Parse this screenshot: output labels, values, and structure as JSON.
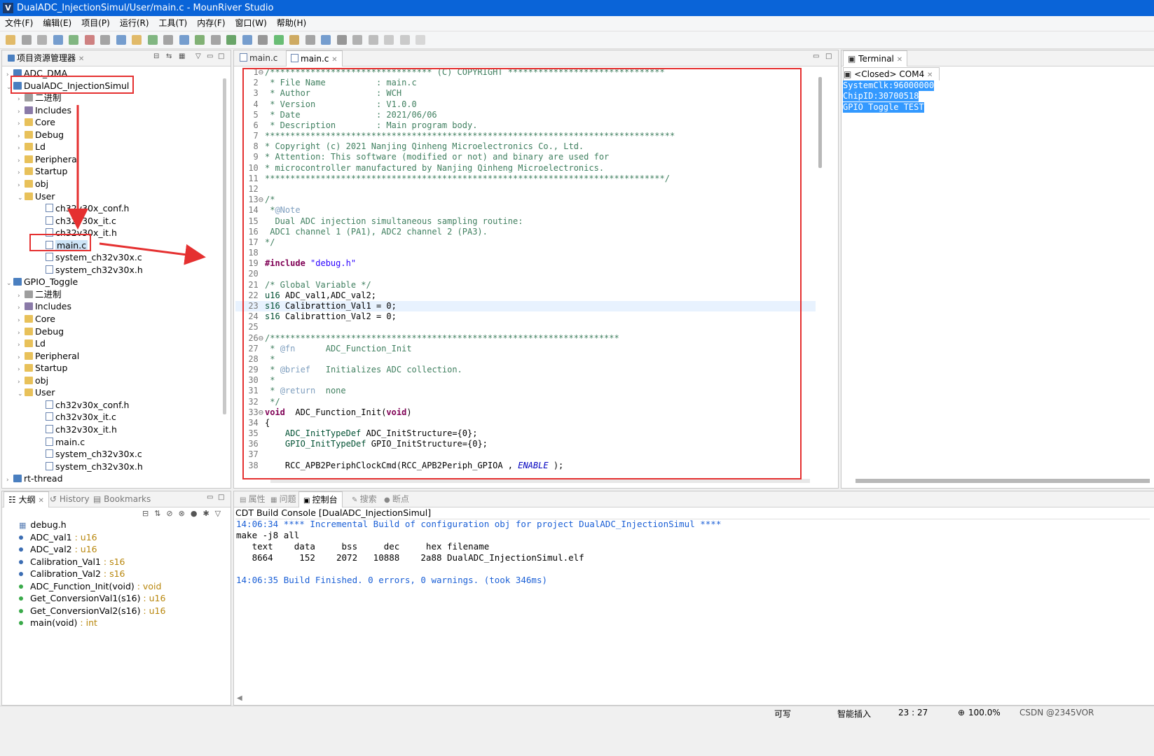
{
  "window": {
    "title": "DualADC_InjectionSimul/User/main.c - MounRiver Studio",
    "logo": "V"
  },
  "menu": [
    "文件(F)",
    "编辑(E)",
    "项目(P)",
    "运行(R)",
    "工具(T)",
    "内存(F)",
    "窗口(W)",
    "帮助(H)"
  ],
  "project_explorer": {
    "title": "项目资源管理器",
    "items": [
      {
        "label": "ADC_DMA",
        "depth": 0,
        "icon": "project",
        "expand": ">"
      },
      {
        "label": "DualADC_InjectionSimul",
        "depth": 0,
        "icon": "project",
        "expand": "v"
      },
      {
        "label": "二进制",
        "depth": 1,
        "icon": "binary",
        "expand": ">"
      },
      {
        "label": "Includes",
        "depth": 1,
        "icon": "library",
        "expand": ">"
      },
      {
        "label": "Core",
        "depth": 1,
        "icon": "folder",
        "expand": ">"
      },
      {
        "label": "Debug",
        "depth": 1,
        "icon": "folder",
        "expand": ">"
      },
      {
        "label": "Ld",
        "depth": 1,
        "icon": "folder",
        "expand": ">"
      },
      {
        "label": "Peripheral",
        "depth": 1,
        "icon": "folder",
        "expand": ">"
      },
      {
        "label": "Startup",
        "depth": 1,
        "icon": "folder",
        "expand": ">"
      },
      {
        "label": "obj",
        "depth": 1,
        "icon": "folder",
        "expand": ">"
      },
      {
        "label": "User",
        "depth": 1,
        "icon": "folder",
        "expand": "v"
      },
      {
        "label": "ch32v30x_conf.h",
        "depth": 2,
        "icon": "file",
        "expand": ""
      },
      {
        "label": "ch32v30x_it.c",
        "depth": 2,
        "icon": "file",
        "expand": ""
      },
      {
        "label": "ch32v30x_it.h",
        "depth": 2,
        "icon": "file",
        "expand": ""
      },
      {
        "label": "main.c",
        "depth": 2,
        "icon": "file",
        "expand": "",
        "selected": true
      },
      {
        "label": "system_ch32v30x.c",
        "depth": 2,
        "icon": "file",
        "expand": ""
      },
      {
        "label": "system_ch32v30x.h",
        "depth": 2,
        "icon": "file",
        "expand": ""
      },
      {
        "label": "GPIO_Toggle",
        "depth": 0,
        "icon": "project",
        "expand": "v"
      },
      {
        "label": "二进制",
        "depth": 1,
        "icon": "binary",
        "expand": ">"
      },
      {
        "label": "Includes",
        "depth": 1,
        "icon": "library",
        "expand": ">"
      },
      {
        "label": "Core",
        "depth": 1,
        "icon": "folder",
        "expand": ">"
      },
      {
        "label": "Debug",
        "depth": 1,
        "icon": "folder",
        "expand": ">"
      },
      {
        "label": "Ld",
        "depth": 1,
        "icon": "folder",
        "expand": ">"
      },
      {
        "label": "Peripheral",
        "depth": 1,
        "icon": "folder",
        "expand": ">"
      },
      {
        "label": "Startup",
        "depth": 1,
        "icon": "folder",
        "expand": ">"
      },
      {
        "label": "obj",
        "depth": 1,
        "icon": "folder",
        "expand": ">"
      },
      {
        "label": "User",
        "depth": 1,
        "icon": "folder",
        "expand": "v"
      },
      {
        "label": "ch32v30x_conf.h",
        "depth": 2,
        "icon": "file",
        "expand": ""
      },
      {
        "label": "ch32v30x_it.c",
        "depth": 2,
        "icon": "file",
        "expand": ""
      },
      {
        "label": "ch32v30x_it.h",
        "depth": 2,
        "icon": "file",
        "expand": ""
      },
      {
        "label": "main.c",
        "depth": 2,
        "icon": "file",
        "expand": ""
      },
      {
        "label": "system_ch32v30x.c",
        "depth": 2,
        "icon": "file",
        "expand": ""
      },
      {
        "label": "system_ch32v30x.h",
        "depth": 2,
        "icon": "file",
        "expand": ""
      },
      {
        "label": "rt-thread",
        "depth": 0,
        "icon": "project",
        "expand": ">"
      }
    ]
  },
  "editor": {
    "tabs": [
      "main.c",
      "main.c"
    ],
    "lines": [
      [
        [
          "c-com",
          "/******************************** (C) COPYRIGHT *******************************"
        ]
      ],
      [
        [
          "c-com",
          " * File Name          : main.c"
        ]
      ],
      [
        [
          "c-com",
          " * Author             : WCH"
        ]
      ],
      [
        [
          "c-com",
          " * Version            : V1.0.0"
        ]
      ],
      [
        [
          "c-com",
          " * Date               : 2021/06/06"
        ]
      ],
      [
        [
          "c-com",
          " * Description        : Main program body."
        ]
      ],
      [
        [
          "c-com",
          "*********************************************************************************"
        ]
      ],
      [
        [
          "c-com",
          "* Copyright (c) 2021 Nanjing Qinheng Microelectronics Co., Ltd."
        ]
      ],
      [
        [
          "c-com",
          "* Attention: This software (modified or not) and binary are used for"
        ]
      ],
      [
        [
          "c-com",
          "* microcontroller manufactured by Nanjing Qinheng Microelectronics."
        ]
      ],
      [
        [
          "c-com",
          "*******************************************************************************/"
        ]
      ],
      [
        [
          "",
          ""
        ]
      ],
      [
        [
          "c-com",
          "/*"
        ]
      ],
      [
        [
          "c-com",
          " *"
        ],
        [
          "c-tag",
          "@Note"
        ]
      ],
      [
        [
          "c-com",
          "  Dual ADC injection simultaneous sampling routine:"
        ]
      ],
      [
        [
          "c-com",
          " ADC1 channel 1 (PA1), ADC2 channel 2 (PA3)."
        ]
      ],
      [
        [
          "c-com",
          "*/"
        ]
      ],
      [
        [
          "",
          ""
        ]
      ],
      [
        [
          "c-kw",
          "#include "
        ],
        [
          "c-str",
          "\"debug.h\""
        ]
      ],
      [
        [
          "",
          ""
        ]
      ],
      [
        [
          "c-com",
          "/* Global Variable */"
        ]
      ],
      [
        [
          "c-ty",
          "u16"
        ],
        [
          "",
          " ADC_val1,ADC_val2;"
        ]
      ],
      [
        [
          "c-ty",
          "s16"
        ],
        [
          "",
          " Calibrattion_Val1 = 0;"
        ]
      ],
      [
        [
          "c-ty",
          "s16"
        ],
        [
          "",
          " Calibrattion_Val2 = 0;"
        ]
      ],
      [
        [
          "",
          ""
        ]
      ],
      [
        [
          "c-com",
          "/*********************************************************************"
        ]
      ],
      [
        [
          "c-com",
          " * "
        ],
        [
          "c-tag",
          "@fn"
        ],
        [
          "c-com",
          "      ADC_Function_Init"
        ]
      ],
      [
        [
          "c-com",
          " *"
        ]
      ],
      [
        [
          "c-com",
          " * "
        ],
        [
          "c-tag",
          "@brief"
        ],
        [
          "c-com",
          "   Initializes ADC collection."
        ]
      ],
      [
        [
          "c-com",
          " *"
        ]
      ],
      [
        [
          "c-com",
          " * "
        ],
        [
          "c-tag",
          "@return"
        ],
        [
          "c-com",
          "  none"
        ]
      ],
      [
        [
          "c-com",
          " */"
        ]
      ],
      [
        [
          "c-kw",
          "void"
        ],
        [
          "",
          "  "
        ],
        [
          "",
          "ADC_Function_Init"
        ],
        [
          "",
          "("
        ],
        [
          "c-kw",
          "void"
        ],
        [
          "",
          ")"
        ]
      ],
      [
        [
          "",
          "{"
        ]
      ],
      [
        [
          "",
          "    "
        ],
        [
          "c-ty",
          "ADC_InitTypeDef"
        ],
        [
          "",
          " ADC_InitStructure={0};"
        ]
      ],
      [
        [
          "",
          "    "
        ],
        [
          "c-ty",
          "GPIO_InitTypeDef"
        ],
        [
          "",
          " GPIO_InitStructure={0};"
        ]
      ],
      [
        [
          "",
          ""
        ]
      ],
      [
        [
          "",
          "    RCC_APB2PeriphClockCmd(RCC_APB2Periph_GPIOA , "
        ],
        [
          "c-it",
          "ENABLE"
        ],
        [
          "",
          " );"
        ]
      ]
    ]
  },
  "terminal": {
    "title": "Terminal",
    "subtab": "<Closed> COM4",
    "lines": [
      "SystemClk:96000000",
      "ChipID:30700518",
      "GPIO Toggle TEST"
    ]
  },
  "outline": {
    "tabs": [
      "大纲",
      "History",
      "Bookmarks"
    ],
    "items": [
      {
        "name": "debug.h",
        "type": "",
        "color": "#5a7fb5",
        "kind": "include"
      },
      {
        "name": "ADC_val1",
        "type": " : u16",
        "color": "#3b6db3"
      },
      {
        "name": "ADC_val2",
        "type": " : u16",
        "color": "#3b6db3"
      },
      {
        "name": "Calibration_Val1",
        "type": " : s16",
        "color": "#3b6db3"
      },
      {
        "name": "Calibration_Val2",
        "type": " : s16",
        "color": "#3b6db3"
      },
      {
        "name": "ADC_Function_Init(void)",
        "type": " : void",
        "color": "#3aaa4a"
      },
      {
        "name": "Get_ConversionVal1(s16)",
        "type": " : u16",
        "color": "#3aaa4a"
      },
      {
        "name": "Get_ConversionVal2(s16)",
        "type": " : u16",
        "color": "#3aaa4a"
      },
      {
        "name": "main(void)",
        "type": " : int",
        "color": "#3aaa4a"
      }
    ]
  },
  "console": {
    "tabs": [
      "属性",
      "问题",
      "控制台",
      "搜索",
      "断点"
    ],
    "header": "CDT Build Console [DualADC_InjectionSimul]",
    "lines": [
      {
        "text": "14:06:34 **** Incremental Build of configuration obj for project DualADC_InjectionSimul ****",
        "color": "#1a5fd6"
      },
      {
        "text": "make -j8 all",
        "color": "#000"
      },
      {
        "text": "   text    data     bss     dec     hex filename",
        "color": "#000"
      },
      {
        "text": "   8664     152    2072   10888    2a88 DualADC_InjectionSimul.elf",
        "color": "#000"
      },
      {
        "text": "",
        "color": "#000"
      },
      {
        "text": "14:06:35 Build Finished. 0 errors, 0 warnings. (took 346ms)",
        "color": "#1a5fd6"
      }
    ]
  },
  "status": {
    "writable": "可写",
    "insert": "智能插入",
    "position": "23 : 27",
    "zoom": "100.0%",
    "watermark": "CSDN @2345VOR"
  },
  "colors": {
    "titlebar": "#0a64d8",
    "annotation": "#e53030",
    "selection": "#3399ff"
  }
}
